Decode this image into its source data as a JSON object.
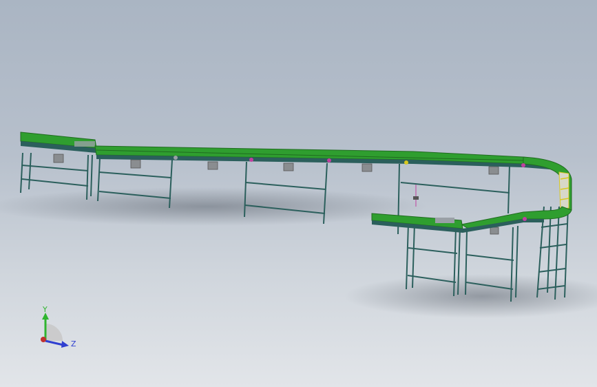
{
  "viewport": {
    "background_top": "#aab5c3",
    "background_bottom": "#e2e5e9"
  },
  "colors": {
    "belt": "#2f9e2f",
    "belt_dark": "#1f6b1f",
    "rail": "#2b5f5c",
    "frame": "#3b6e69",
    "motor": "#8a8d90",
    "accent_magenta": "#c040a0",
    "accent_yellow": "#d8c820",
    "shadow": "#6f7680"
  },
  "triad": {
    "y_label": "Y",
    "z_label": "Z",
    "y_color": "#2fb52f",
    "z_color": "#2f3fd0",
    "x_color": "#c03030",
    "icon": "coordinate-triad-icon"
  }
}
